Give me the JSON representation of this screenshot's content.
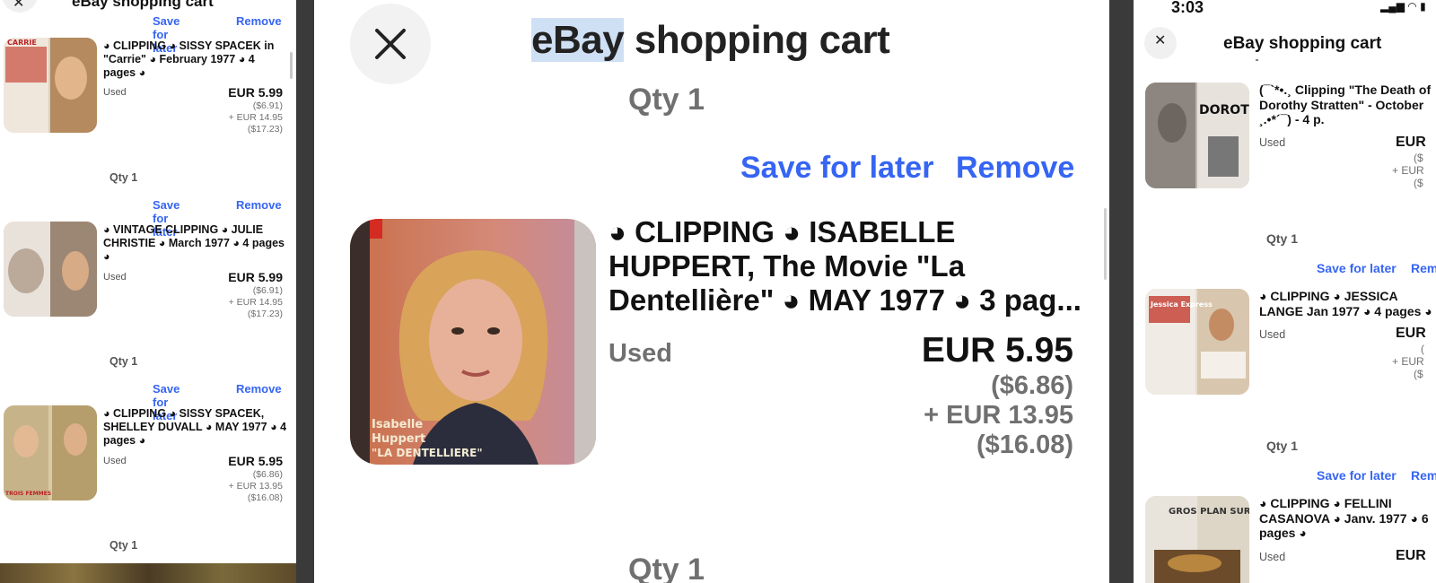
{
  "left": {
    "title": "eBay shopping cart",
    "close_glyph": "✕",
    "items": [
      {
        "actions": {
          "save": "Save for later",
          "remove": "Remove"
        },
        "title": "◕ CLIPPING ◕ SISSY SPACEK in \"Carrie\" ◕ February 1977 ◕ 4 pages ◕",
        "condition": "Used",
        "price": "EUR 5.99",
        "price_usd": "($6.91)",
        "shipping": "+ EUR 14.95",
        "shipping_usd": "($17.23)",
        "qty": "Qty 1"
      },
      {
        "actions": {
          "save": "Save for later",
          "remove": "Remove"
        },
        "title": "◕ VINTAGE CLIPPING ◕ JULIE CHRISTIE ◕ March 1977 ◕ 4 pages ◕",
        "condition": "Used",
        "price": "EUR 5.99",
        "price_usd": "($6.91)",
        "shipping": "+ EUR 14.95",
        "shipping_usd": "($17.23)",
        "qty": "Qty 1"
      },
      {
        "actions": {
          "save": "Save for later",
          "remove": "Remove"
        },
        "title": "◕ CLIPPING ◕ SISSY SPACEK, SHELLEY DUVALL ◕ MAY 1977 ◕ 4 pages ◕",
        "condition": "Used",
        "price": "EUR 5.95",
        "price_usd": "($6.86)",
        "shipping": "+ EUR 13.95",
        "shipping_usd": "($16.08)",
        "qty": "Qty 1"
      }
    ],
    "thumb_texts": [
      "CARRIE",
      "TROIS FEMMES"
    ]
  },
  "middle": {
    "title_highlight": "eBay",
    "title_rest": " shopping cart",
    "qty_top": "Qty 1",
    "actions": {
      "save": "Save for later",
      "remove": "Remove"
    },
    "item": {
      "title": "◕ CLIPPING ◕ ISABELLE HUPPERT, The Movie \"La Dentellière\" ◕ MAY 1977 ◕ 3 pag...",
      "condition": "Used",
      "price": "EUR 5.95",
      "price_usd": "($6.86)",
      "shipping": "+ EUR 13.95",
      "shipping_usd": "($16.08)",
      "thumb_caption_1": "Isabelle",
      "thumb_caption_2": "Huppert",
      "thumb_caption_3": "\"LA DENTELLIERE\""
    },
    "qty_bottom": "Qty 1"
  },
  "right": {
    "status_time": "3:03",
    "status_icons": "▂▄▆ ◠ ▮",
    "title": "eBay shopping cart",
    "close_glyph": "✕",
    "items": [
      {
        "title": "(¯`*•.¸ Clipping \"The Death of Dorothy Stratten\" - October ¸.•*´¯) - 4 p.",
        "condition": "Used",
        "price": "EUR",
        "price_usd": "($",
        "shipping": "+ EUR",
        "shipping_usd": "($",
        "qty": "Qty 1",
        "thumb_text": "DOROTHY"
      },
      {
        "actions": {
          "save": "Save for later",
          "remove": "Rem"
        },
        "title": "◕ CLIPPING ◕ JESSICA LANGE Jan 1977 ◕ 4 pages ◕",
        "condition": "Used",
        "price": "EUR",
        "price_usd": "(",
        "shipping": "+ EUR",
        "shipping_usd": "($",
        "qty": "Qty 1",
        "thumb_text": "Jessica Express"
      },
      {
        "actions": {
          "save": "Save for later",
          "remove": "Rem"
        },
        "title": "◕ CLIPPING ◕ FELLINI CASANOVA ◕ Janv. 1977 ◕ 6 pages ◕",
        "condition": "Used",
        "price": "EUR",
        "thumb_text": "GROS PLAN SUR"
      }
    ]
  },
  "colors": {
    "link_blue": "#3665f3",
    "muted_grey": "#707070",
    "title_highlight": "#cfe0f5"
  }
}
